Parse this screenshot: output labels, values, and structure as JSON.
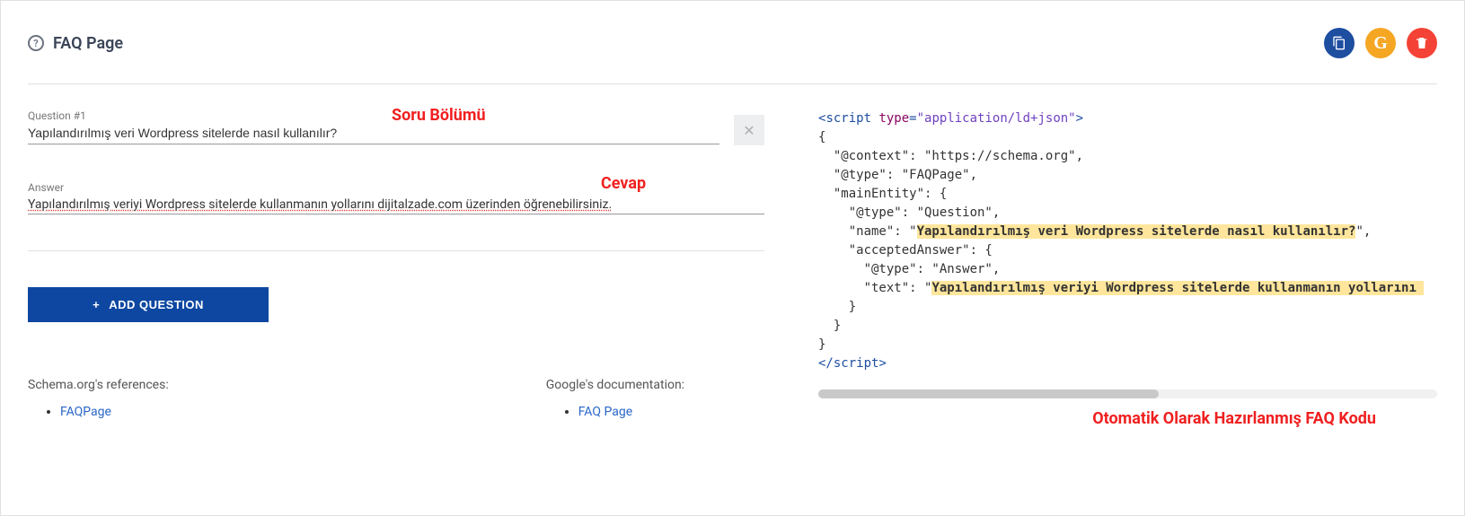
{
  "header": {
    "title": "FAQ Page"
  },
  "actions": {
    "copy": "Copy",
    "google": "G",
    "delete": "Delete"
  },
  "form": {
    "question_label": "Question #1",
    "question_value": "Yapılandırılmış veri Wordpress sitelerde nasıl kullanılır?",
    "answer_label": "Answer",
    "answer_value": "Yapılandırılmış veriyi Wordpress sitelerde kullanmanın yollarını dijitalzade.com üzerinden öğrenebilirsiniz.",
    "add_button": "ADD QUESTION"
  },
  "annotations": {
    "question": "Soru Bölümü",
    "answer": "Cevap",
    "code": "Otomatik Olarak Hazırlanmış FAQ Kodu"
  },
  "code": {
    "script_open_tag": "script",
    "type_attr_name": "type",
    "type_attr_value": "\"application/ld+json\"",
    "line_open_brace": "{",
    "line_context": "  \"@context\": \"https://schema.org\",",
    "line_type_faq": "  \"@type\": \"FAQPage\",",
    "line_main_entity": "  \"mainEntity\": {",
    "line_type_question": "    \"@type\": \"Question\",",
    "line_name_key": "    \"name\": \"",
    "line_name_hl": "Yapılandırılmış veri Wordpress sitelerde nasıl kullanılır?",
    "line_name_tail": "\",",
    "line_accepted": "    \"acceptedAnswer\": {",
    "line_type_answer": "      \"@type\": \"Answer\",",
    "line_text_key": "      \"text\": \"",
    "line_text_hl": "Yapılandırılmış veriyi Wordpress sitelerde kullanmanın yollarını ",
    "line_close1": "    }",
    "line_close2": "  }",
    "line_close3": "}",
    "script_close_tag": "script"
  },
  "refs": {
    "schema_heading": "Schema.org's references:",
    "schema_link": "FAQPage",
    "google_heading": "Google's documentation:",
    "google_link": "FAQ Page"
  }
}
